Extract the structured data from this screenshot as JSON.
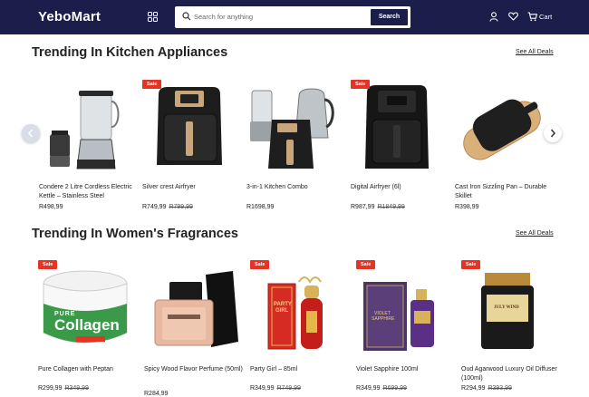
{
  "header": {
    "logo": "YeboMart",
    "search_placeholder": "Search for anything",
    "search_button": "Search",
    "cart_label": "Cart"
  },
  "sections": [
    {
      "title": "Trending In Kitchen Appliances",
      "see_all": "See All Deals",
      "products": [
        {
          "name": "Condere 2 Litre Cordless Electric Kettle – Stainless Steel",
          "price": "R498,99",
          "old_price": "",
          "sale": ""
        },
        {
          "name": "Silver crest Airfryer",
          "price": "R749,99",
          "old_price": "R799,99",
          "sale": "Sale"
        },
        {
          "name": "3-in-1 Kitchen Combo",
          "price": "R1698,99",
          "old_price": "",
          "sale": ""
        },
        {
          "name": "Digital Airfryer (6l)",
          "price": "R987,99",
          "old_price": "R1849,99",
          "sale": "Sale"
        },
        {
          "name": "Cast Iron Sizzling Pan – Durable Skillet",
          "price": "R398,99",
          "old_price": "",
          "sale": ""
        }
      ]
    },
    {
      "title": "Trending In Women's Fragrances",
      "see_all": "See All Deals",
      "products": [
        {
          "name": "Pure Collagen with Peptan",
          "price": "R299,99",
          "old_price": "R349,99",
          "sale": "Sale",
          "image_text": [
            "PURE",
            "Collagen"
          ]
        },
        {
          "name": "Spicy Wood Flavor Perfume (50ml)",
          "price": "R284,99",
          "old_price": "",
          "sale": ""
        },
        {
          "name": "Party Girl – 85ml",
          "price": "R349,99",
          "old_price": "R749,99",
          "sale": "Sale",
          "image_text": [
            "PARTY",
            "GIRL"
          ]
        },
        {
          "name": "Violet Sapphire 100ml",
          "price": "R349,99",
          "old_price": "R699,99",
          "sale": "Sale",
          "image_text": [
            "VIOLET",
            "SAPPHIRE"
          ]
        },
        {
          "name": "Oud Agarwood Luxury Oil Diffuser (100ml)",
          "price": "R294,99",
          "old_price": "R393,99",
          "sale": "Sale",
          "image_text": [
            "JULY WIND"
          ]
        }
      ]
    }
  ],
  "icons": [
    "grid-icon",
    "search-icon",
    "user-icon",
    "heart-icon",
    "cart-icon",
    "chevron-left-icon",
    "chevron-right-icon"
  ],
  "colors": {
    "header_bg": "#1b1e4b",
    "sale_badge": "#e53424"
  }
}
